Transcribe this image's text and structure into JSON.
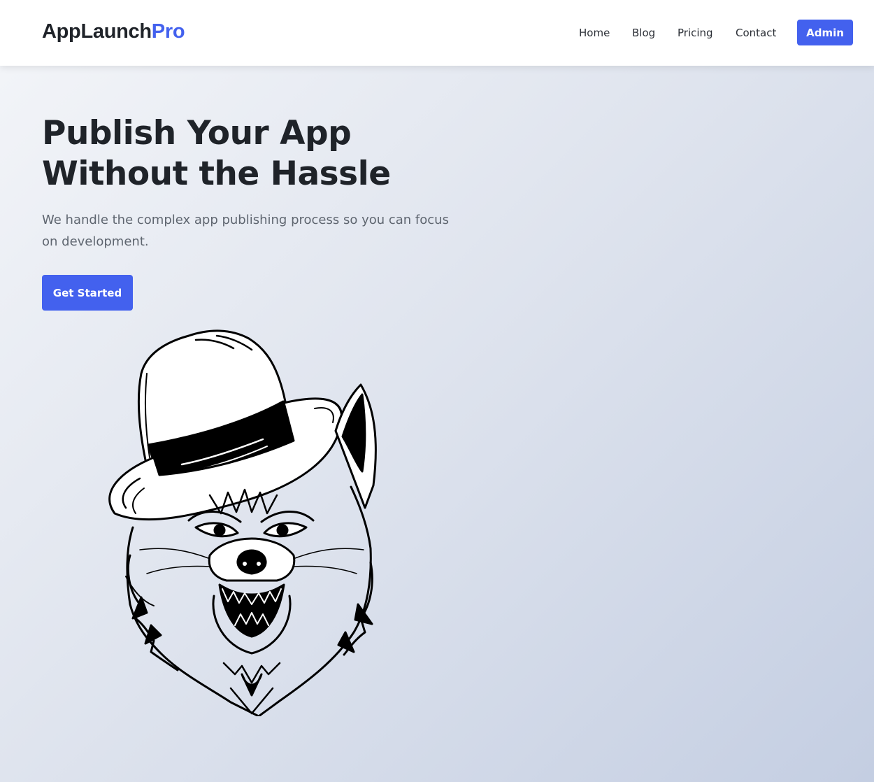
{
  "brand": {
    "name_main": "AppLaunch",
    "name_accent": "Pro",
    "accent_color": "#4361ee"
  },
  "nav": {
    "links": [
      "Home",
      "Blog",
      "Pricing",
      "Contact"
    ],
    "admin_label": "Admin"
  },
  "hero": {
    "title": "Publish Your App Without the Hassle",
    "subtitle": "We handle the complex app publishing process so you can focus on development.",
    "cta_label": "Get Started",
    "illustration": "wolf-in-fedora-illustration"
  }
}
